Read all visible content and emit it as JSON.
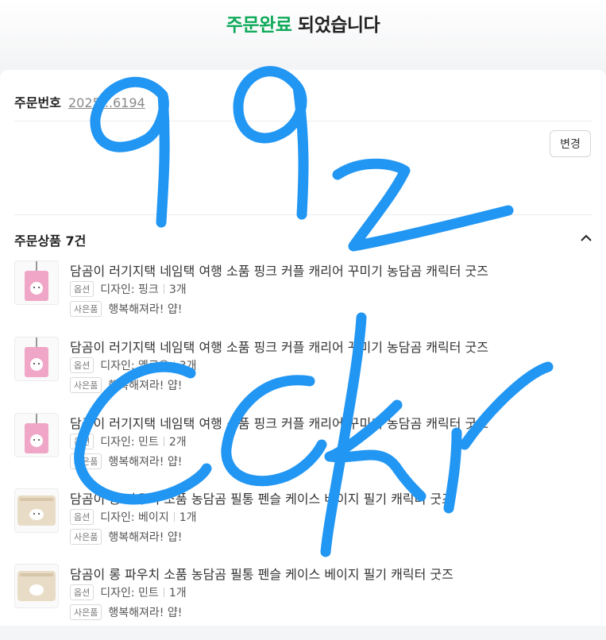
{
  "header": {
    "title_accent": "주문완료",
    "title_rest": " 되었습니다"
  },
  "order": {
    "label": "주문번호",
    "number": "2025...6194"
  },
  "change_button": "변경",
  "section": {
    "title": "주문상품 7건"
  },
  "items": [
    {
      "name": "담곰이 러기지택 네임택 여행 소품 핑크 커플 캐리어 꾸미기 농담곰 캐릭터 굿즈",
      "option_tag": "옵션",
      "option": "디자인: 핑크",
      "qty": "3개",
      "gift_tag": "사은품",
      "gift": "행복해져라! 얍!"
    },
    {
      "name": "담곰이 러기지택 네임택 여행 소품 핑크 커플 캐리어 꾸미기 농담곰 캐릭터 굿즈",
      "option_tag": "옵션",
      "option": "디자인: 옐로우",
      "qty": "3개",
      "gift_tag": "사은품",
      "gift": "행복해져라! 얍!"
    },
    {
      "name": "담곰이 러기지택 네임택 여행 소품 핑크 커플 캐리어 꾸미기 농담곰 캐릭터 굿즈",
      "option_tag": "옵션",
      "option": "디자인: 민트",
      "qty": "2개",
      "gift_tag": "사은품",
      "gift": "행복해져라! 얍!"
    },
    {
      "name": "담곰이 롱 파우치 소품 농담곰 필통 펜슬 케이스 베이지 필기 캐릭터 굿즈",
      "option_tag": "옵션",
      "option": "디자인: 베이지",
      "qty": "1개",
      "gift_tag": "사은품",
      "gift": "행복해져라! 얍!"
    },
    {
      "name": "담곰이 롱 파우치 소품 농담곰 필통 펜슬 케이스 베이지 필기 캐릭터 굿즈",
      "option_tag": "옵션",
      "option": "디자인: 민트",
      "qty": "1개",
      "gift_tag": "사은품",
      "gift": "행복해져라! 얍!"
    }
  ],
  "colors": {
    "accent": "#0fa95a",
    "scribble": "#2196f3"
  }
}
